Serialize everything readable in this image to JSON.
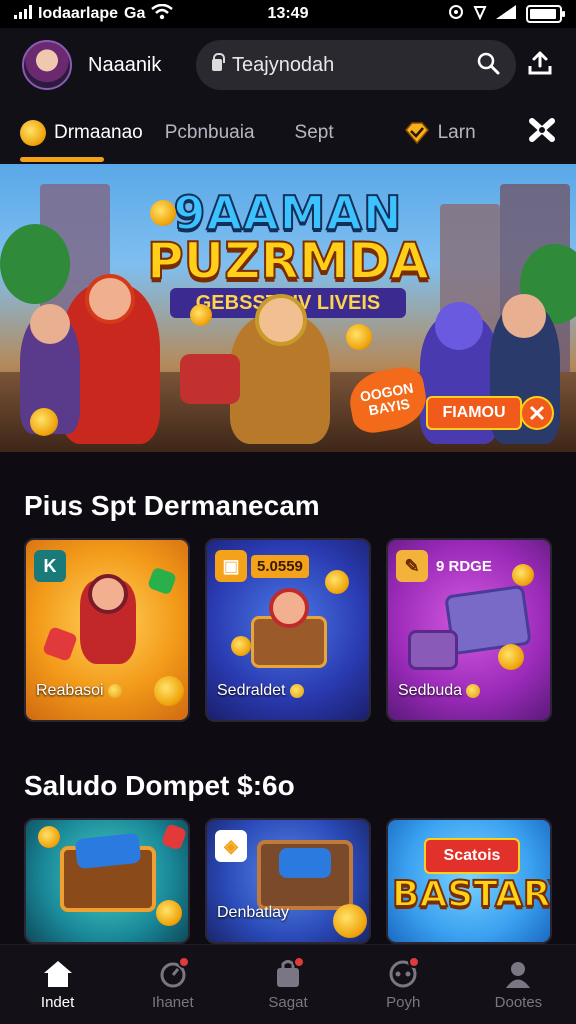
{
  "status_bar": {
    "carrier": "Iodaarlape",
    "network": "Ga",
    "time": "13:49"
  },
  "header": {
    "username": "Naaanik",
    "search": {
      "value": "Teajynodah"
    }
  },
  "tabs": [
    {
      "label": "Drmaanao",
      "icon": "coin-icon",
      "active": true
    },
    {
      "label": "Pcbnbuaia",
      "active": false
    },
    {
      "label": "Sept",
      "active": false
    },
    {
      "label": "Larn",
      "icon": "diamond-icon",
      "active": false
    },
    {
      "label": "",
      "icon": "x-icon",
      "active": false
    }
  ],
  "banner": {
    "title_line1": "9AAMAN",
    "title_line2": "PUZRMDA",
    "title_line3": "GEBSSTIUV LIVEIS",
    "badge_left": "OOGON BAYIS",
    "badge_right": "FIAMOU"
  },
  "section1": {
    "title": "Pius Spt Dermanecam",
    "cards": [
      {
        "label": "Reabasoi",
        "tag": "",
        "theme": "orange"
      },
      {
        "label": "Sedraldet",
        "tag": "5.0559",
        "theme": "blue"
      },
      {
        "label": "Sedbuda",
        "tag": "9 RDGE",
        "theme": "purple"
      }
    ]
  },
  "section2": {
    "title": "Saludo Dompet $:6o",
    "cards": [
      {
        "label": "",
        "theme": "teal"
      },
      {
        "label": "Denbatlay",
        "theme": "blue"
      },
      {
        "label": "BASTARY",
        "sublabel": "Scatois",
        "theme": "sky"
      }
    ]
  },
  "bottom_nav": [
    {
      "label": "Indet",
      "icon": "home-icon",
      "active": true,
      "badge": false
    },
    {
      "label": "Ihanet",
      "icon": "timer-icon",
      "active": false,
      "badge": true
    },
    {
      "label": "Sagat",
      "icon": "bag-icon",
      "active": false,
      "badge": true
    },
    {
      "label": "Poyh",
      "icon": "gamepad-icon",
      "active": false,
      "badge": true
    },
    {
      "label": "Dootes",
      "icon": "profile-icon",
      "active": false,
      "badge": false
    }
  ],
  "colors": {
    "background": "#0e0c12",
    "accent": "#f3a21a",
    "search_bg": "#2b2930",
    "badge_red": "#e23a3a"
  }
}
